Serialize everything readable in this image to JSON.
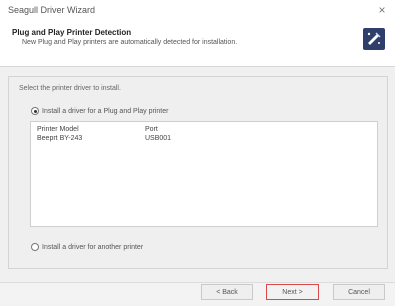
{
  "window": {
    "title": "Seagull Driver Wizard",
    "close_label": "×"
  },
  "header": {
    "title": "Plug and Play Printer Detection",
    "subtitle": "New Plug and Play printers are automatically detected for installation.",
    "icon": "wizard-icon"
  },
  "main": {
    "select_label": "Select the printer driver to install.",
    "option_pnp": {
      "label": "Install a driver for a Plug and Play printer",
      "checked": true
    },
    "option_other": {
      "label": "Install a driver for another printer",
      "checked": false
    },
    "table": {
      "columns": [
        "Printer Model",
        "Port"
      ],
      "rows": [
        {
          "model": "Beeprt BY-243",
          "port": "USB001"
        }
      ]
    }
  },
  "footer": {
    "back_label": "< Back",
    "next_label": "Next >",
    "cancel_label": "Cancel"
  },
  "colors": {
    "primary_button_border": "#d94a4a",
    "header_icon_bg": "#2f3f6a"
  }
}
